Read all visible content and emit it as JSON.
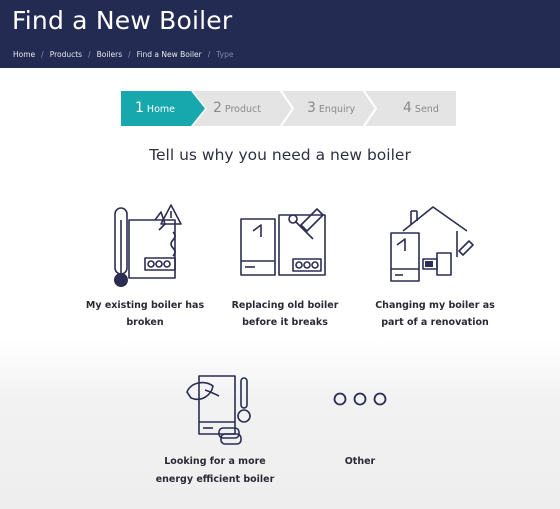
{
  "header": {
    "title": "Find a New Boiler",
    "breadcrumb": [
      "Home",
      "Products",
      "Boilers",
      "Find a New Boiler"
    ],
    "breadcrumb_current": "Type"
  },
  "steps": [
    {
      "number": "1",
      "label": "Home",
      "active": true
    },
    {
      "number": "2",
      "label": "Product",
      "active": false
    },
    {
      "number": "3",
      "label": "Enquiry",
      "active": false
    },
    {
      "number": "4",
      "label": "Send",
      "active": false
    }
  ],
  "question": "Tell us why you need a new boiler",
  "options": [
    {
      "line1": "My existing boiler has",
      "line2": "broken",
      "icon": "broken-boiler-icon"
    },
    {
      "line1": "Replacing old boiler",
      "line2": "before it breaks",
      "icon": "replace-boiler-icon"
    },
    {
      "line1": "Changing my boiler as",
      "line2": "part of a renovation",
      "icon": "renovation-icon"
    },
    {
      "line1": "Looking for a more",
      "line2": "energy efficient boiler",
      "icon": "energy-efficient-icon"
    },
    {
      "line1": "Other",
      "line2": "",
      "icon": "more-dots-icon"
    }
  ],
  "colors": {
    "header_bg": "#232b52",
    "accent": "#17a8ad",
    "step_inactive": "#e4e4e4"
  }
}
